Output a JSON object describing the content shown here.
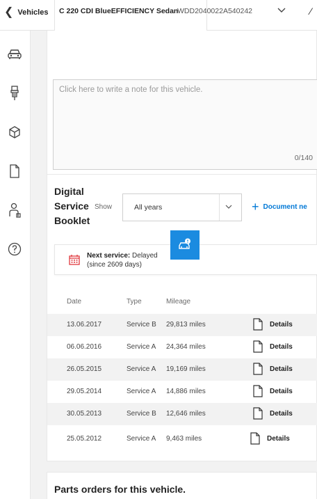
{
  "topbar": {
    "back_label": "Vehicles",
    "vehicle_model": "C 220 CDI BlueEFFICIENCY Sedan",
    "vehicle_vin": "WDD2040022A540242"
  },
  "sidebar": {
    "items": [
      {
        "icon": "car-icon"
      },
      {
        "icon": "spark-plug-icon"
      },
      {
        "icon": "parts-box-icon"
      },
      {
        "icon": "document-icon"
      },
      {
        "icon": "technician-icon"
      },
      {
        "icon": "help-icon"
      }
    ]
  },
  "note": {
    "placeholder": "Click here to write a note for this vehicle.",
    "char_count": "0/140"
  },
  "booklet": {
    "title_lines": [
      "Digital",
      "Service",
      "Booklet"
    ],
    "show_label": "Show",
    "year_filter": "All years",
    "document_new_label": "Document ne",
    "next_service_label": "Next service:",
    "next_service_status": "Delayed",
    "next_service_since": "(since 2609 days)",
    "columns": [
      "Date",
      "Type",
      "Mileage"
    ],
    "details_label": "Details",
    "rows": [
      {
        "date": "13.06.2017",
        "type": "Service B",
        "mileage": "29,813 miles"
      },
      {
        "date": "06.06.2016",
        "type": "Service A",
        "mileage": "24,364 miles"
      },
      {
        "date": "26.05.2015",
        "type": "Service A",
        "mileage": "19,169 miles"
      },
      {
        "date": "29.05.2014",
        "type": "Service A",
        "mileage": "14,886 miles"
      },
      {
        "date": "30.05.2013",
        "type": "Service B",
        "mileage": "12,646 miles"
      },
      {
        "date": "25.05.2012",
        "type": "Service A",
        "mileage": "9,463 miles"
      }
    ]
  },
  "parts": {
    "title": "Parts orders for this vehicle."
  },
  "colors": {
    "accent": "#0078d6",
    "badge": "#1b8be0",
    "calendar": "#e0393e"
  }
}
